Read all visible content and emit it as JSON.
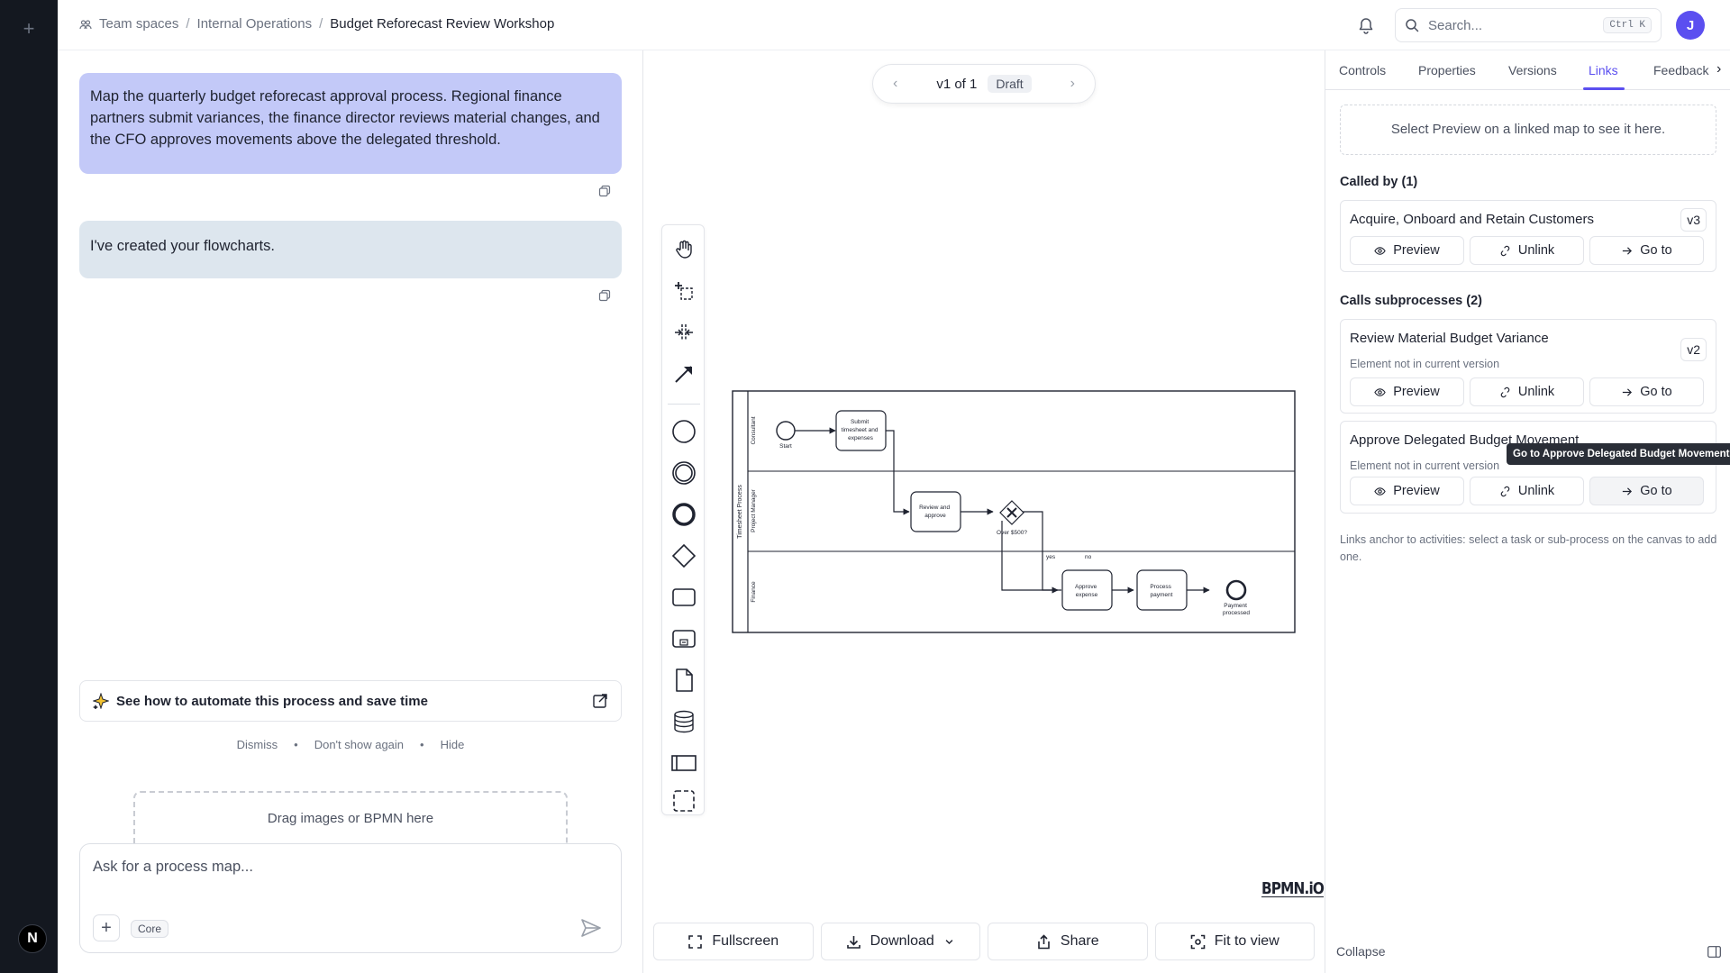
{
  "breadcrumb": {
    "team_spaces": "Team spaces",
    "parent": "Internal Operations",
    "current": "Budget Reforecast Review Workshop"
  },
  "header": {
    "search_placeholder": "Search...",
    "search_shortcut": "Ctrl K",
    "avatar_initial": "J"
  },
  "rail": {
    "logo": "N"
  },
  "chat": {
    "user_message": "Map the quarterly budget reforecast approval process. Regional finance partners submit variances, the finance director reviews material changes, and the CFO approves movements above the delegated threshold.",
    "assistant_message": "I've created your flowcharts.",
    "promo": "See how to automate this process and save time",
    "promo_actions": [
      "Dismiss",
      "Don't show again",
      "Hide"
    ],
    "dropzone": "Drag images or BPMN here",
    "composer_placeholder": "Ask for a process map...",
    "mode_badge": "Core"
  },
  "canvas": {
    "version_label": "v1 of 1",
    "status_badge": "Draft",
    "watermark": "BPMN.iO",
    "buttons": {
      "fullscreen": "Fullscreen",
      "download": "Download",
      "share": "Share",
      "fit": "Fit to view"
    }
  },
  "diagram": {
    "pool": "Timesheet Process",
    "lanes": [
      "Consultant",
      "Project Manager",
      "Finance"
    ],
    "start": "Start",
    "task_submit": [
      "Submit",
      "timesheet and",
      "expenses"
    ],
    "task_review": [
      "Review and",
      "approve"
    ],
    "gateway": "Over $500?",
    "flow_yes": "yes",
    "flow_no": "no",
    "task_approve": [
      "Approve",
      "expense"
    ],
    "task_payment": [
      "Process",
      "payment"
    ],
    "end": [
      "Payment",
      "processed"
    ]
  },
  "right_panel": {
    "tabs": [
      "Controls",
      "Properties",
      "Versions",
      "Links",
      "Feedback"
    ],
    "active_tab": "Links",
    "note": "Select Preview on a linked map to see it here.",
    "called_by_title": "Called by (1)",
    "called_by": [
      {
        "title": "Acquire, Onboard and Retain Customers",
        "version": "v3"
      }
    ],
    "calls_title": "Calls subprocesses (2)",
    "calls": [
      {
        "title": "Review Material Budget Variance",
        "subtitle": "Element not in current version",
        "version": "v2"
      },
      {
        "title": "Approve Delegated Budget Movement",
        "subtitle": "Element not in current version"
      }
    ],
    "btn_preview": "Preview",
    "btn_unlink": "Unlink",
    "btn_goto": "Go to",
    "tooltip": "Go to Approve Delegated Budget Movement",
    "footnote": "Links anchor to activities: select a task or sub-process on the canvas to add one.",
    "collapse": "Collapse"
  }
}
